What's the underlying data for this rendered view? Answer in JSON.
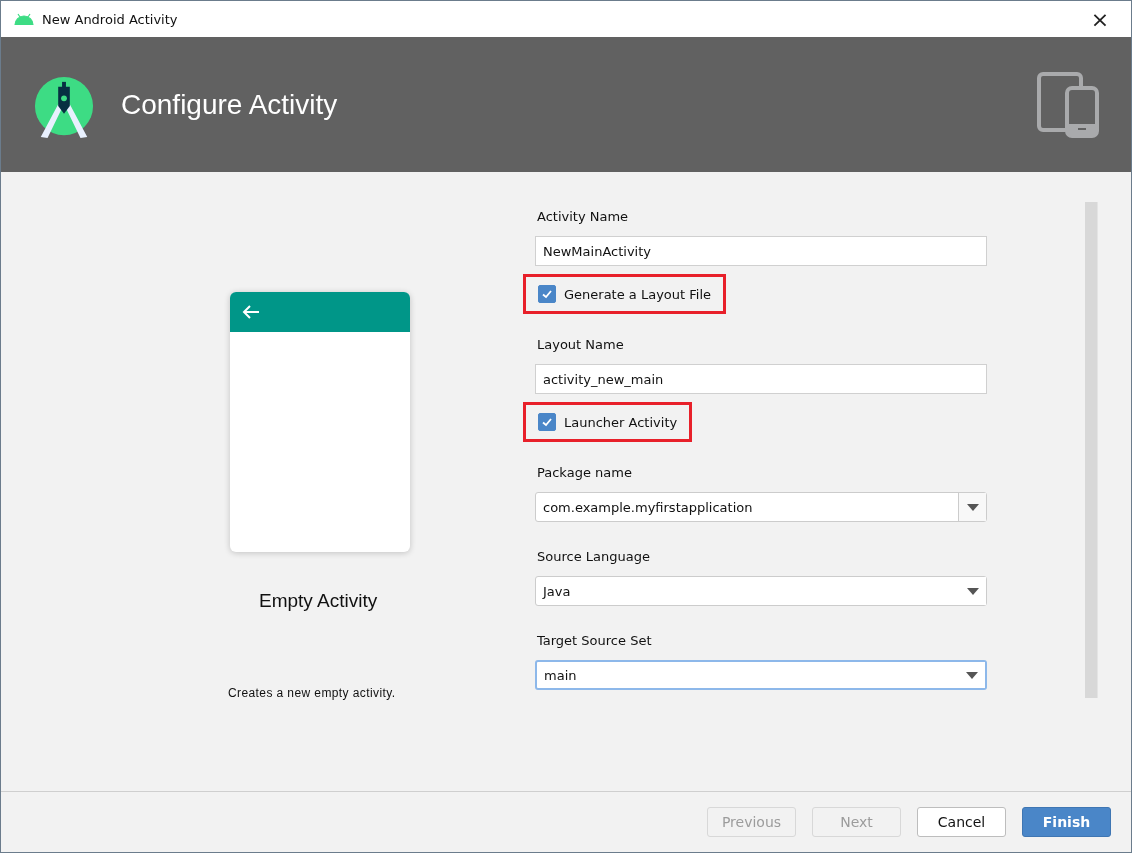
{
  "window": {
    "title": "New Android Activity",
    "close": "×"
  },
  "header": {
    "title": "Configure Activity"
  },
  "template": {
    "name": "Empty Activity",
    "description": "Creates a new empty activity."
  },
  "form": [
    {
      "kind": "label",
      "text": "Activity Name"
    },
    {
      "kind": "text",
      "value": "NewMainActivity"
    },
    {
      "kind": "checkbox",
      "text": "Generate a Layout File",
      "checked": true,
      "highlighted": true
    },
    {
      "kind": "label",
      "text": "Layout Name"
    },
    {
      "kind": "text",
      "value": "activity_new_main"
    },
    {
      "kind": "checkbox",
      "text": "Launcher Activity",
      "checked": true,
      "highlighted": true
    },
    {
      "kind": "label",
      "text": "Package name"
    },
    {
      "kind": "combo",
      "value": "com.example.myfirstapplication",
      "focused": false
    },
    {
      "kind": "label",
      "text": "Source Language"
    },
    {
      "kind": "dropdown",
      "value": "Java",
      "focused": false
    },
    {
      "kind": "label",
      "text": "Target Source Set"
    },
    {
      "kind": "dropdown",
      "value": "main",
      "focused": true
    }
  ],
  "buttons": [
    {
      "label": "Previous",
      "disabled": true,
      "primary": false
    },
    {
      "label": "Next",
      "disabled": true,
      "primary": false
    },
    {
      "label": "Cancel",
      "disabled": false,
      "primary": false
    },
    {
      "label": "Finish",
      "disabled": false,
      "primary": true
    }
  ]
}
